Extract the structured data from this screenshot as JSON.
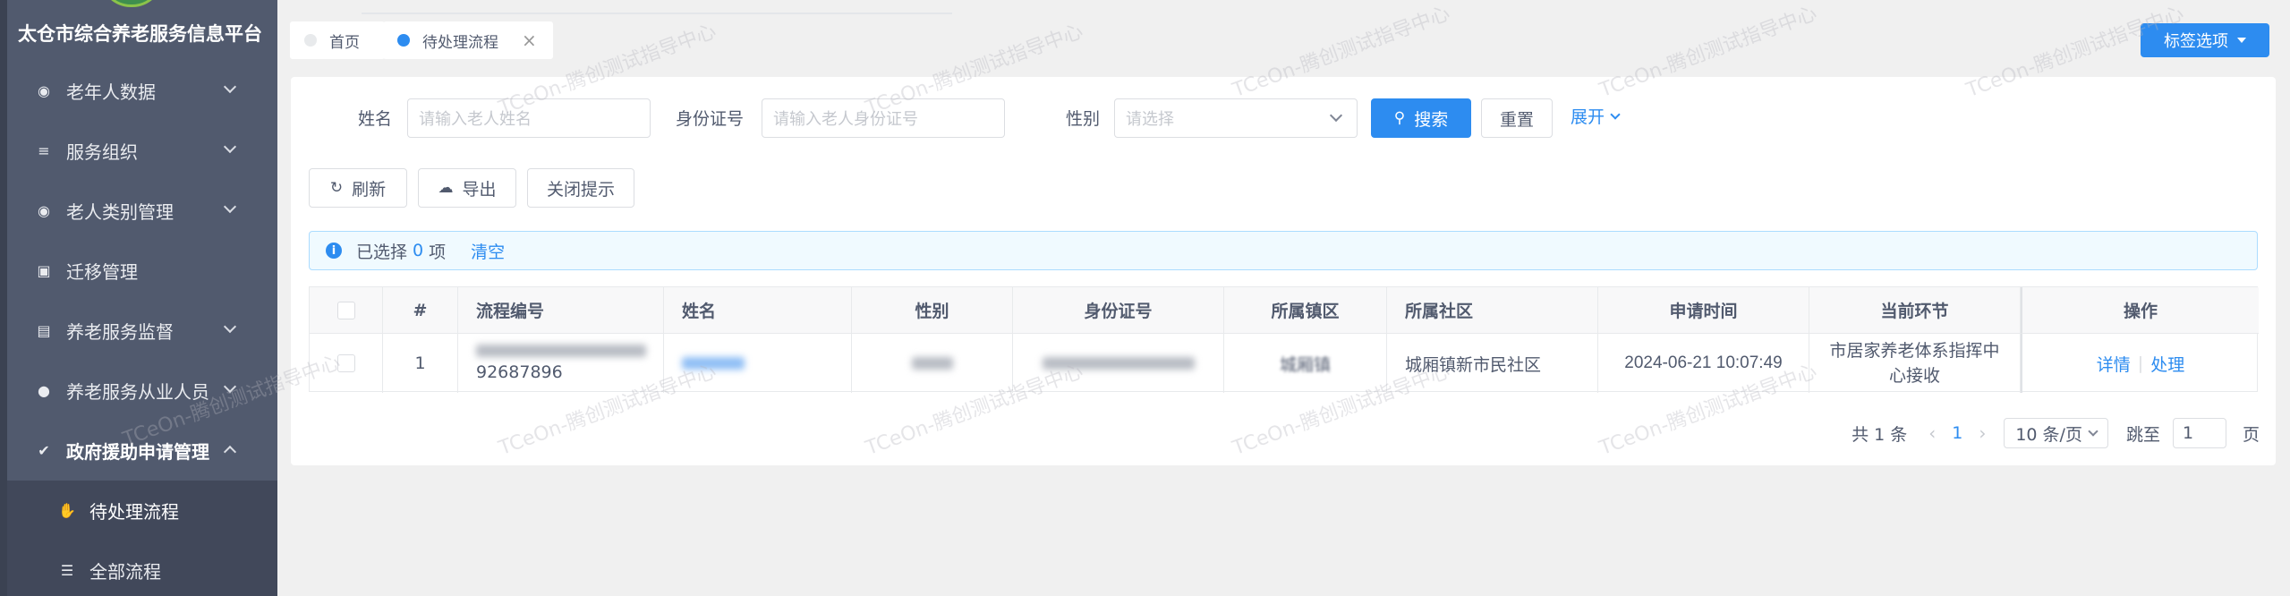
{
  "app": {
    "title": "太仓市综合养老服务信息平台"
  },
  "sidebar": {
    "items": [
      {
        "label": "老年人数据",
        "icon": "user-data-icon"
      },
      {
        "label": "服务组织",
        "icon": "list-icon"
      },
      {
        "label": "老人类别管理",
        "icon": "category-icon"
      },
      {
        "label": "迁移管理",
        "icon": "chart-icon"
      },
      {
        "label": "养老服务监督",
        "icon": "clipboard-icon"
      },
      {
        "label": "养老服务从业人员",
        "icon": "people-icon"
      },
      {
        "label": "政府援助申请管理",
        "icon": "check-circle-icon"
      },
      {
        "label": "待处理流程",
        "icon": "hand-icon"
      },
      {
        "label": "全部流程",
        "icon": "filter-icon"
      }
    ]
  },
  "tabs": [
    {
      "label": "首页"
    },
    {
      "label": "待处理流程",
      "close": "×"
    }
  ],
  "tag_options": {
    "label": "标签选项"
  },
  "search": {
    "name_label": "姓名",
    "name_placeholder": "请输入老人姓名",
    "id_label": "身份证号",
    "id_placeholder": "请输入老人身份证号",
    "gender_label": "性别",
    "gender_placeholder": "请选择",
    "search_button": "搜索",
    "reset_button": "重置",
    "expand_link": "展开"
  },
  "toolbar": {
    "refresh": "刷新",
    "export": "导出",
    "close_tip": "关闭提示"
  },
  "alert": {
    "prefix": "已选择",
    "count": "0",
    "suffix": "项",
    "clear": "清空"
  },
  "table": {
    "headers": [
      "#",
      "流程编号",
      "姓名",
      "性别",
      "身份证号",
      "所属镇区",
      "所属社区",
      "申请时间",
      "当前环节",
      "操作"
    ],
    "rows": [
      {
        "index": "1",
        "flow_no": "92687896",
        "town": "城厢镇",
        "community": "城厢镇新市民社区",
        "apply_time": "2024-06-21 10:07:49",
        "stage": "市居家养老体系指挥中心接收",
        "action_detail": "详情",
        "action_separator": "|",
        "action_process": "处理"
      }
    ]
  },
  "pager": {
    "total": "共 1 条",
    "prev": "‹",
    "current": "1",
    "next": "›",
    "page_size": "10 条/页",
    "jump_label": "跳至",
    "jump_value": "1",
    "page_unit": "页"
  },
  "watermark": {
    "text": "TCeOn-腾创测试指导中心"
  }
}
